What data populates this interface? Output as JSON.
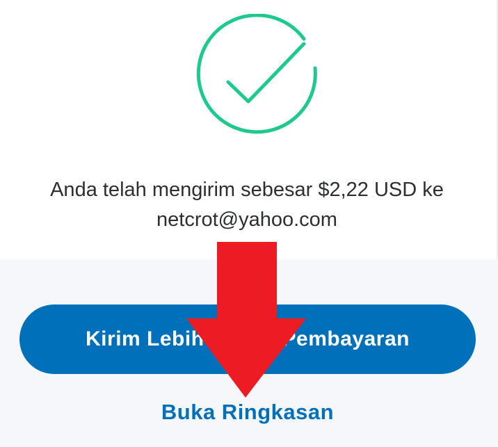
{
  "confirmation": {
    "icon": "checkmark-circle-icon",
    "icon_color": "#1ec98d",
    "message_line1": "Anda telah mengirim sebesar $2,22 USD ke",
    "message_line2": "netcrot@yahoo.com"
  },
  "actions": {
    "primary_label_left": "Kirim Lebih",
    "primary_label_right": "Pembayaran",
    "primary_color": "#0070ba",
    "secondary_label": "Buka Ringkasan"
  },
  "annotation": {
    "icon": "arrow-down-icon",
    "color": "#ed1c24"
  }
}
